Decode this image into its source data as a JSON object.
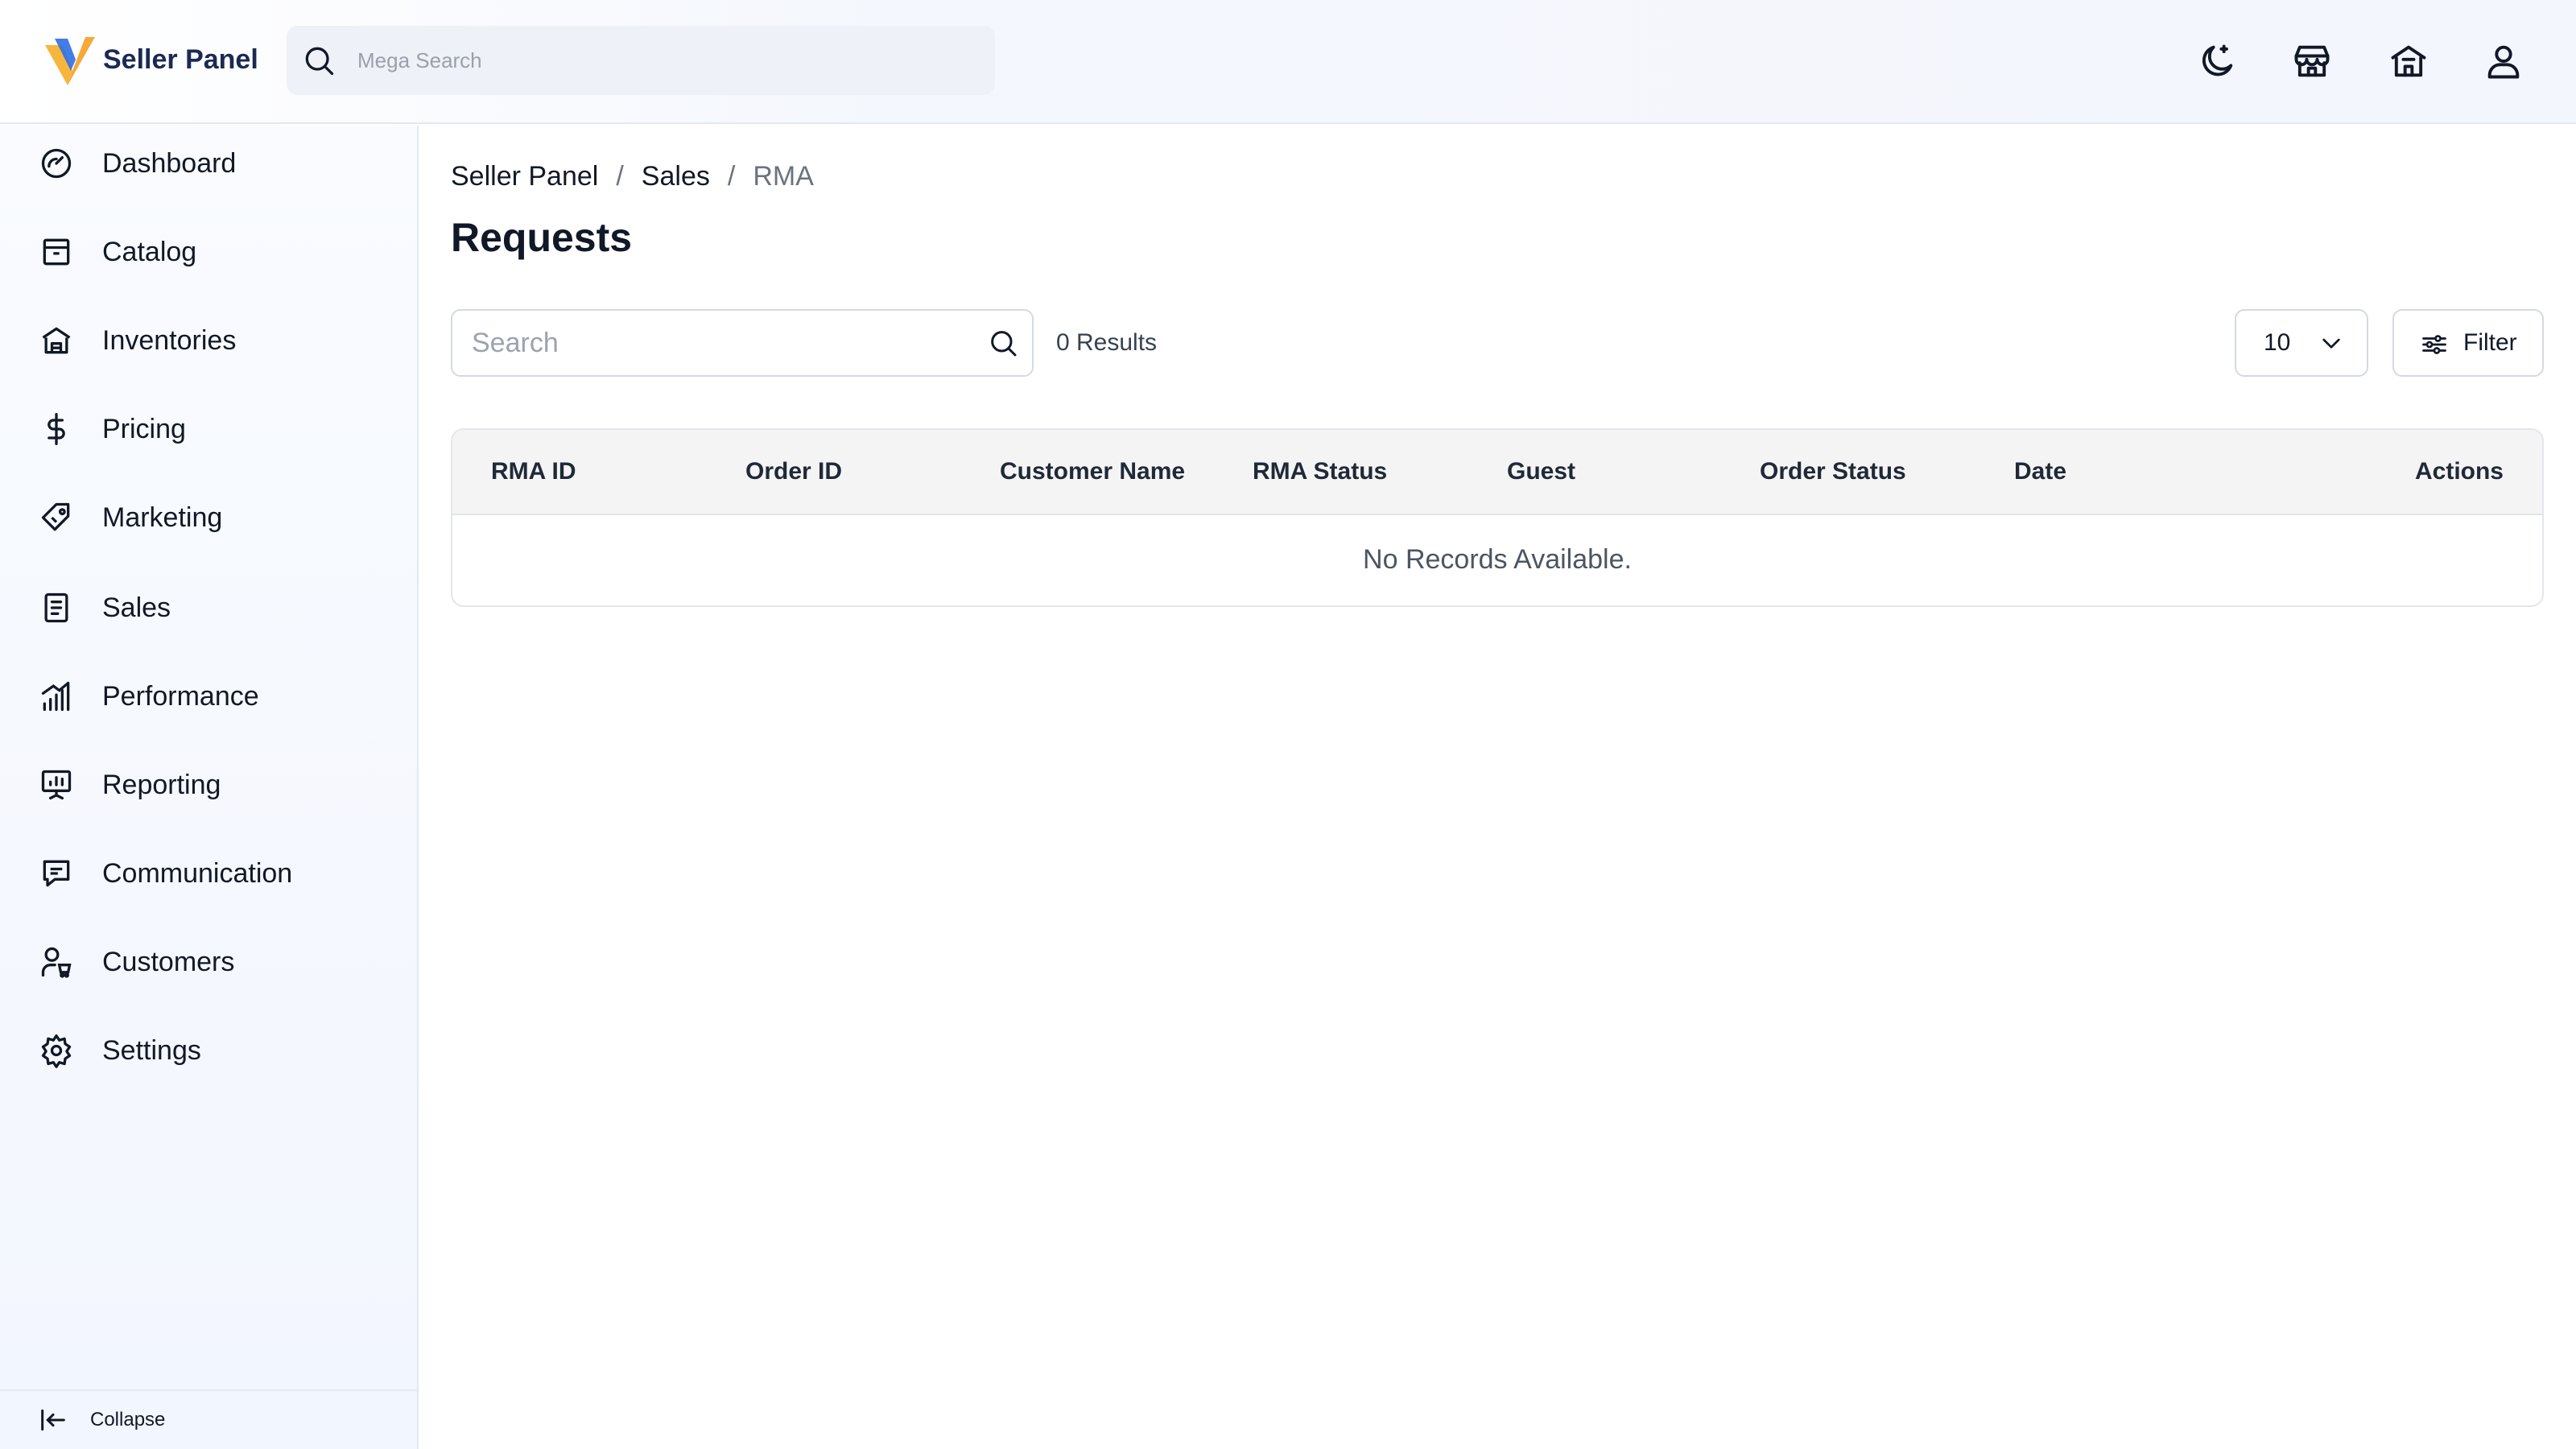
{
  "header": {
    "brand": "Seller Panel",
    "mega_search_placeholder": "Mega Search",
    "icons": [
      "moon-icon",
      "store-icon",
      "building-icon",
      "user-icon"
    ]
  },
  "sidebar": {
    "items": [
      {
        "label": "Dashboard",
        "icon": "gauge-icon"
      },
      {
        "label": "Catalog",
        "icon": "box-icon"
      },
      {
        "label": "Inventories",
        "icon": "warehouse-icon"
      },
      {
        "label": "Pricing",
        "icon": "dollar-icon"
      },
      {
        "label": "Marketing",
        "icon": "tag-icon"
      },
      {
        "label": "Sales",
        "icon": "receipt-icon"
      },
      {
        "label": "Performance",
        "icon": "bar-chart-icon"
      },
      {
        "label": "Reporting",
        "icon": "presentation-icon"
      },
      {
        "label": "Communication",
        "icon": "message-icon"
      },
      {
        "label": "Customers",
        "icon": "user-cart-icon"
      },
      {
        "label": "Settings",
        "icon": "gear-icon"
      }
    ],
    "collapse_label": "Collapse"
  },
  "breadcrumb": {
    "items": [
      "Seller Panel",
      "Sales",
      "RMA"
    ],
    "separator": "/"
  },
  "page": {
    "title": "Requests",
    "search_placeholder": "Search",
    "results_text": "0 Results",
    "per_page": "10",
    "filter_label": "Filter"
  },
  "table": {
    "columns": [
      "RMA ID",
      "Order ID",
      "Customer Name",
      "RMA Status",
      "Guest",
      "Order Status",
      "Date",
      "Actions"
    ],
    "empty_message": "No Records Available."
  },
  "colors": {
    "logo_blue": "#2f6fe4",
    "logo_yellow": "#f6b63d",
    "brand_text": "#1b2a52"
  }
}
